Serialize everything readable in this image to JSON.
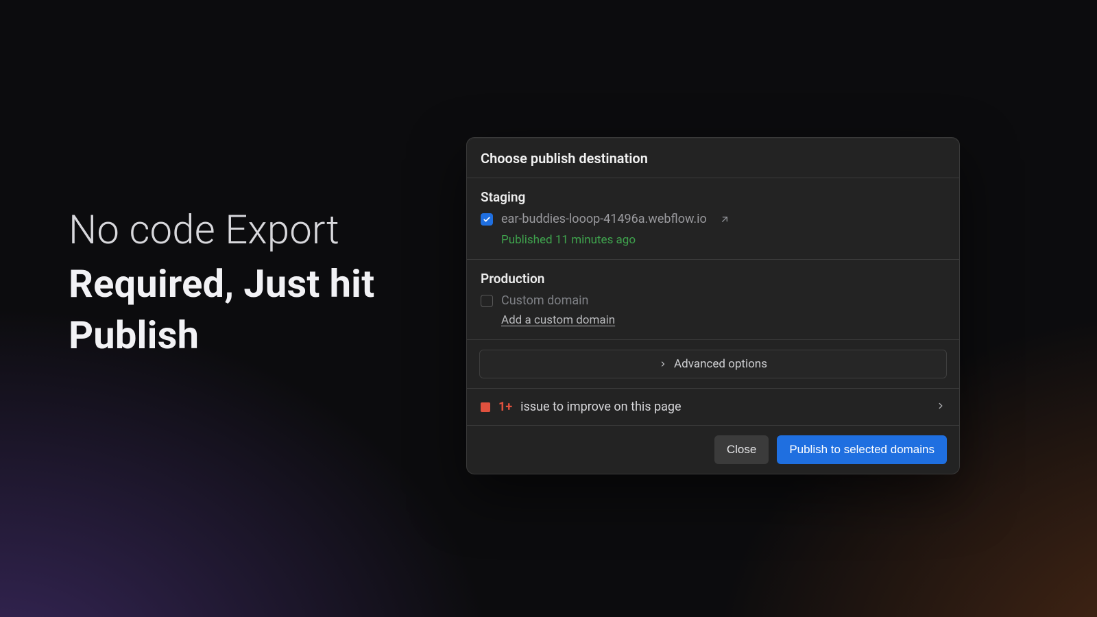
{
  "hero": {
    "line1": "No code Export",
    "line2": "Required, Just hit Publish"
  },
  "dialog": {
    "title": "Choose publish destination",
    "staging": {
      "heading": "Staging",
      "domain": "ear-buddies-looop-41496a.webflow.io",
      "checked": true,
      "published_status": "Published 11 minutes ago"
    },
    "production": {
      "heading": "Production",
      "custom_domain_label": "Custom domain",
      "checked": false,
      "add_link": "Add a custom domain"
    },
    "advanced_label": "Advanced options",
    "issue": {
      "count": "1+",
      "text": "issue to improve on this page"
    },
    "buttons": {
      "close": "Close",
      "publish": "Publish to selected domains"
    }
  },
  "colors": {
    "accent": "#1f6fe0",
    "success": "#3fa24d",
    "danger": "#e0513e"
  }
}
